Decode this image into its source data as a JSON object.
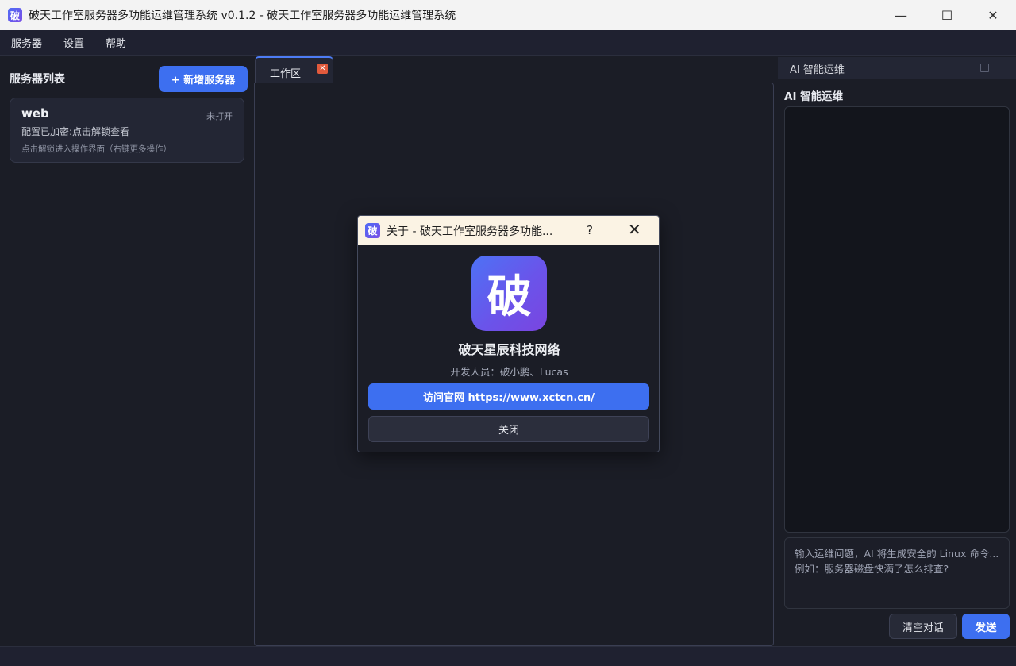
{
  "window": {
    "app_icon_char": "破",
    "title": "破天工作室服务器多功能运维管理系统 v0.1.2 - 破天工作室服务器多功能运维管理系统",
    "minimize_glyph": "—",
    "maximize_glyph": "☐",
    "close_glyph": "✕"
  },
  "menu": [
    "服务器",
    "设置",
    "帮助"
  ],
  "left_panel": {
    "title": "服务器列表",
    "add_button": "+ 新增服务器",
    "servers": [
      {
        "name": "web",
        "status": "未打开",
        "desc": "配置已加密:点击解锁查看",
        "hint": "点击解锁进入操作界面（右键更多操作）"
      }
    ]
  },
  "workspace": {
    "tab_label": "工作区",
    "tab_close_glyph": "✕"
  },
  "ai_panel": {
    "tab_label": "AI 智能运维",
    "heading": "AI 智能运维",
    "input_placeholder_line1": "输入运维问题，AI 将生成安全的 Linux 命令...",
    "input_placeholder_line2": "例如：服务器磁盘快满了怎么排查?",
    "clear_button": "清空对话",
    "send_button": "发送"
  },
  "about_dialog": {
    "title": "关于 - 破天工作室服务器多功能...",
    "help_glyph": "?",
    "close_glyph": "✕",
    "logo_char": "破",
    "company": "破天星辰科技网络",
    "developers": "开发人员：破小鹏、Lucas",
    "visit_button": "访问官网   https://www.xctcn.cn/",
    "close_button": "关闭"
  },
  "colors": {
    "accent": "#3d6ff0",
    "background": "#1b1d26",
    "tab_close": "#e25a3c"
  }
}
